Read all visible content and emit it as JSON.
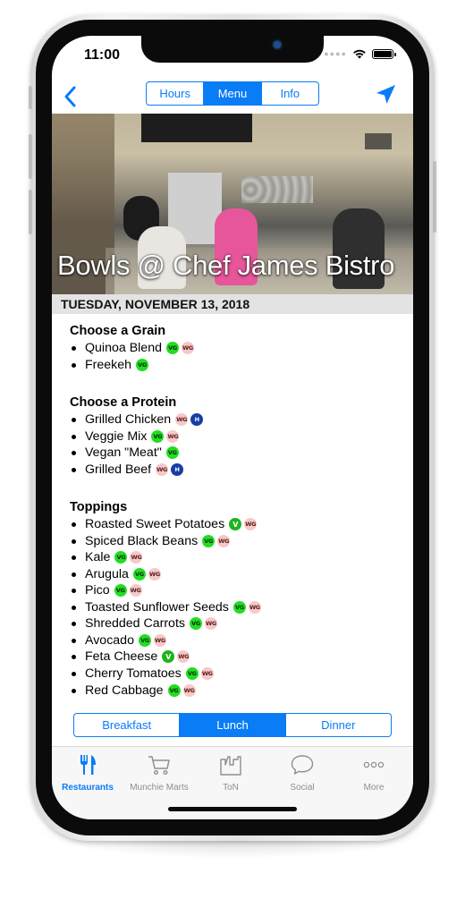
{
  "status_bar": {
    "time": "11:00"
  },
  "nav": {
    "segments": [
      {
        "label": "Hours",
        "active": false
      },
      {
        "label": "Menu",
        "active": true
      },
      {
        "label": "Info",
        "active": false
      }
    ]
  },
  "hero": {
    "title": "Bowls @ Chef James Bistro"
  },
  "date": "TUESDAY, NOVEMBER 13, 2018",
  "menu": {
    "sections": [
      {
        "title": "Choose a Grain",
        "items": [
          {
            "name": "Quinoa Blend",
            "badges": [
              "VG",
              "WG"
            ]
          },
          {
            "name": "Freekeh",
            "badges": [
              "VG"
            ]
          }
        ]
      },
      {
        "title": "Choose a Protein",
        "items": [
          {
            "name": "Grilled Chicken",
            "badges": [
              "WG",
              "H"
            ]
          },
          {
            "name": "Veggie Mix",
            "badges": [
              "VG",
              "WG"
            ]
          },
          {
            "name": "Vegan \"Meat\"",
            "badges": [
              "VG"
            ]
          },
          {
            "name": "Grilled Beef",
            "badges": [
              "WG",
              "H"
            ]
          }
        ]
      },
      {
        "title": "Toppings",
        "items": [
          {
            "name": "Roasted Sweet Potatoes",
            "badges": [
              "V",
              "WG"
            ]
          },
          {
            "name": "Spiced Black Beans",
            "badges": [
              "VG",
              "WG"
            ]
          },
          {
            "name": "Kale",
            "badges": [
              "VG",
              "WG"
            ]
          },
          {
            "name": "Arugula",
            "badges": [
              "VG",
              "WG"
            ]
          },
          {
            "name": "Pico",
            "badges": [
              "VG",
              "WG"
            ]
          },
          {
            "name": "Toasted Sunflower Seeds",
            "badges": [
              "VG",
              "WG"
            ]
          },
          {
            "name": "Shredded Carrots",
            "badges": [
              "VG",
              "WG"
            ]
          },
          {
            "name": "Avocado",
            "badges": [
              "VG",
              "WG"
            ]
          },
          {
            "name": "Feta Cheese",
            "badges": [
              "V",
              "WG"
            ]
          },
          {
            "name": "Cherry Tomatoes",
            "badges": [
              "VG",
              "WG"
            ]
          },
          {
            "name": "Red Cabbage",
            "badges": [
              "VG",
              "WG"
            ]
          }
        ]
      }
    ]
  },
  "meal_tabs": [
    {
      "label": "Breakfast",
      "active": false
    },
    {
      "label": "Lunch",
      "active": true
    },
    {
      "label": "Dinner",
      "active": false
    }
  ],
  "tab_bar": [
    {
      "label": "Restaurants",
      "icon": "fork-knife-icon",
      "active": true
    },
    {
      "label": "Munchie Marts",
      "icon": "cart-icon",
      "active": false
    },
    {
      "label": "ToN",
      "icon": "building-icon",
      "active": false
    },
    {
      "label": "Social",
      "icon": "speech-bubble-icon",
      "active": false
    },
    {
      "label": "More",
      "icon": "more-dots-icon",
      "active": false
    }
  ],
  "colors": {
    "accent": "#0a7cf5",
    "badge_vg": "#22dd22",
    "badge_wg": "#f6c8c8",
    "badge_h": "#153fa6",
    "badge_v": "#1db31d"
  }
}
